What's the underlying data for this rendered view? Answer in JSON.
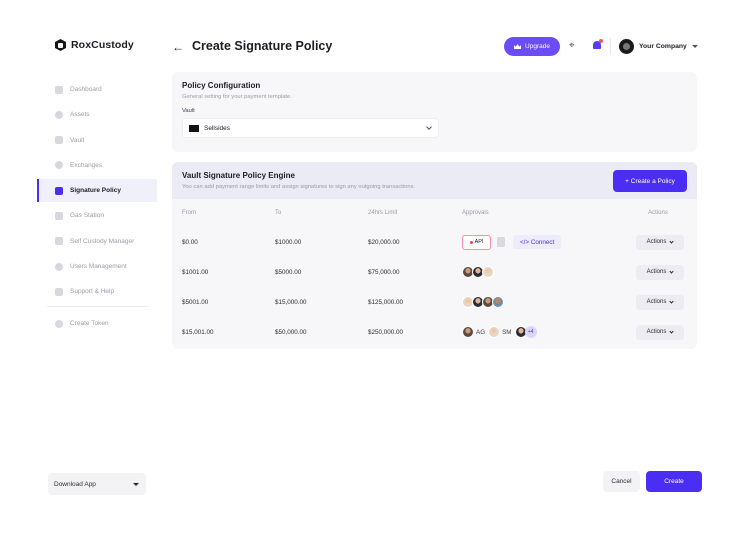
{
  "brand": {
    "name": "RoxCustody"
  },
  "sidebar": {
    "items": [
      {
        "label": "Dashboard"
      },
      {
        "label": "Assets"
      },
      {
        "label": "Vault"
      },
      {
        "label": "Exchanges"
      },
      {
        "label": "Signature Policy",
        "active": true
      },
      {
        "label": "Gas Station"
      },
      {
        "label": "Self Custody Manager"
      },
      {
        "label": "Users Management"
      },
      {
        "label": "Support & Help"
      },
      {
        "label": "Create Token"
      }
    ],
    "download_label": "Download App"
  },
  "header": {
    "title": "Create Signature Policy",
    "upgrade_label": "Upgrade",
    "company_label": "Your Company"
  },
  "policy_config": {
    "title": "Policy Configuration",
    "subtitle": "General setting for your payment template.",
    "vault_label": "Vault",
    "vault_value": "Sellsides"
  },
  "engine": {
    "title": "Vault Signature Policy Engine",
    "subtitle": "You can add payment range limits and assign signatures to sign any outgoing transactions.",
    "create_label": "+ Create a Policy",
    "columns": [
      "From",
      "To",
      "24hrs Limit",
      "Approvals",
      "Actions"
    ],
    "rows": [
      {
        "from": "$0.00",
        "to": "$1000.00",
        "limit": "$20,000.00"
      },
      {
        "from": "$1001.00",
        "to": "$5000.00",
        "limit": "$75,000.00"
      },
      {
        "from": "$5001.00",
        "to": "$15,000.00",
        "limit": "$125,000.00"
      },
      {
        "from": "$15,001.00",
        "to": "$50,000.00",
        "limit": "$250,000.00"
      }
    ],
    "api_label": "API",
    "connect_label": "</> Connect",
    "initials_ag": "AG",
    "initials_sm": "SM",
    "more_label": "+4",
    "actions_label": "Actions"
  },
  "footer": {
    "cancel_label": "Cancel",
    "create_label": "Create"
  },
  "colors": {
    "accent": "#4b2ef5",
    "upgrade": "#6c4cf6",
    "panel": "#f7f7fa"
  }
}
